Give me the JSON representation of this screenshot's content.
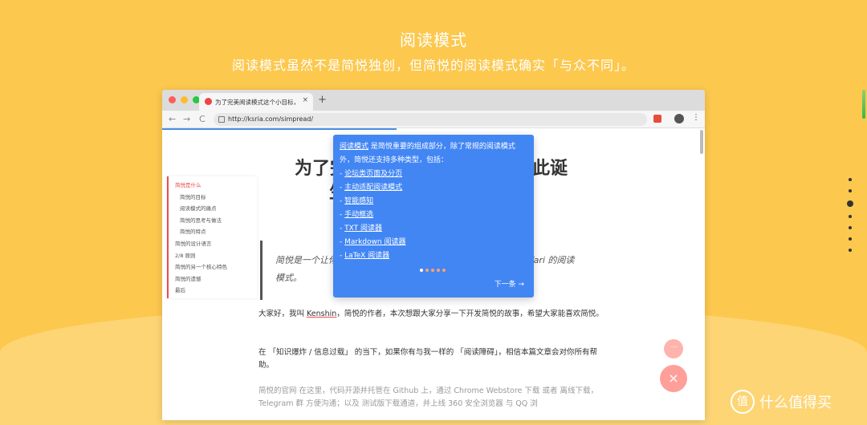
{
  "hero": {
    "title": "阅读模式",
    "subtitle": "阅读模式虽然不是简悦独创，但简悦的阅读模式确实「与众不同」。"
  },
  "browser": {
    "tab_title": "为了完美阅读模式这个小目标，",
    "tab_close": "×",
    "new_tab": "+",
    "url": "http://ksria.com/simpread/",
    "back": "←",
    "forward": "→",
    "reload": "C",
    "menu": "⋮"
  },
  "article": {
    "title": "为了完美阅读模式这个小目标，因此诞生了简悦——一个让你瞬间进入沉浸式阅读的扩展",
    "title_line1": "为了完美",
    "title_line1_end": "因此诞",
    "title_line2": "生了",
    "title_line2_end": "读的",
    "toc": [
      "简悦是什么",
      "简悦的目标",
      "阅读模式的痛点",
      "简悦的思考与做法",
      "简悦的特点",
      "简悦的设计语言",
      "2/8 原则",
      "简悦的另一个核心特色",
      "简悦的遗憾",
      "最后"
    ],
    "quote": "简悦是一个让你瞬间进入沉浸式阅读的 Chrome 扩展，类似 Safari 的阅读模式。",
    "quote_visible_start": "简悦是一个让你",
    "quote_visible_end": "afari 的阅读",
    "quote_line2": "模式。",
    "p1": "大家好，我叫 Kenshin，简悦的作者，本次想跟大家分享一下开发简悦的故事，希望大家能喜欢简悦。",
    "p1_name": "Kenshin",
    "p1_before": "大家好，我叫 ",
    "p1_after": "，简悦的作者，本次想跟大家分享一下开发简悦的故事，希望大家能喜欢简悦。",
    "p2": "在 「知识爆炸 / 信息过载」 的当下，如果你有与我一样的 「阅读障碍」，相信本篇文章会对你所有帮助。",
    "p3": "简悦的官网 在这里，代码开源并托管在 Github 上，通过 Chrome Webstore 下载 或者 离线下载，Telegram 群 方便沟通；以及 测试版下载通道，并上线 360 安全浏览器 与 QQ 浏"
  },
  "popover": {
    "intro_link": "阅读模式",
    "intro_text": " 是简悦重要的组成部分，除了常规的阅读模式外，简悦还支持多种类型，包括：",
    "items": [
      "论坛类页面及分页",
      "主动适配阅读模式",
      "智能感知",
      "手动框选",
      "TXT 阅读器",
      "Markdown 阅读器",
      "LaTeX 阅读器"
    ],
    "next": "下一条 →"
  },
  "fab": {
    "more": "···",
    "close": "×"
  },
  "watermark": {
    "logo": "值",
    "text": "什么值得买"
  },
  "colors": {
    "background": "#fcc84e",
    "popover": "#4286f4",
    "accent": "#e84d4d"
  }
}
